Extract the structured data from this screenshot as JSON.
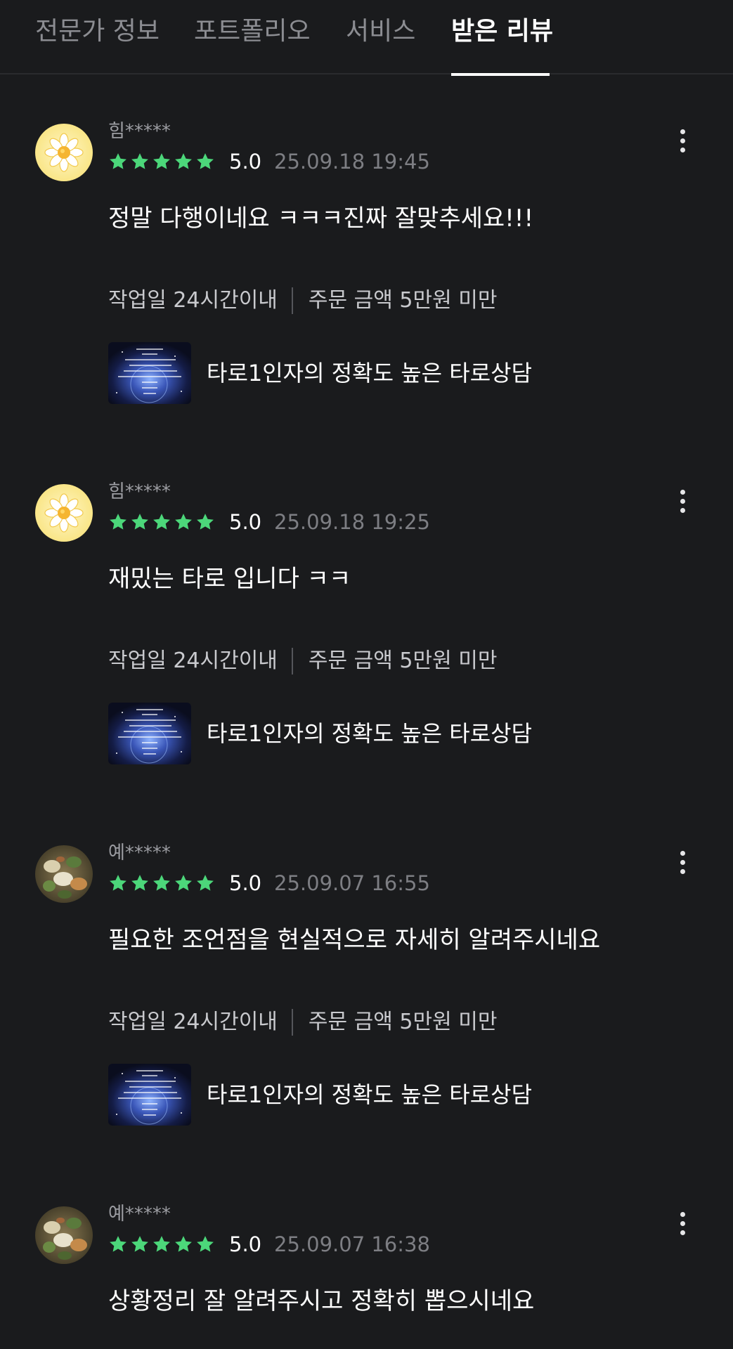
{
  "tabs": [
    {
      "label": "전문가 정보",
      "active": false
    },
    {
      "label": "포트폴리오",
      "active": false
    },
    {
      "label": "서비스",
      "active": false
    },
    {
      "label": "받은 리뷰",
      "active": true
    }
  ],
  "colors": {
    "background": "#1a1b1d",
    "star": "#4cd77a",
    "muted_text": "#7d7e83"
  },
  "reviews": [
    {
      "reviewer": "힘*****",
      "avatar_icon": "flower-avatar-icon",
      "rating": "5.0",
      "stars": 5,
      "date": "25.09.18 19:45",
      "comment": "정말 다행이네요 ㅋㅋㅋ진짜 잘맞추세요!!!",
      "work_period": "작업일 24시간이내",
      "order_amount": "주문 금액 5만원 미만",
      "service_title": "타로1인자의 정확도 높은 타로상담"
    },
    {
      "reviewer": "힘*****",
      "avatar_icon": "flower-avatar-icon",
      "rating": "5.0",
      "stars": 5,
      "date": "25.09.18 19:25",
      "comment": "재밌는 타로 입니다 ㅋㅋ",
      "work_period": "작업일 24시간이내",
      "order_amount": "주문 금액 5만원 미만",
      "service_title": "타로1인자의 정확도 높은 타로상담"
    },
    {
      "reviewer": "예*****",
      "avatar_icon": "food-photo-avatar-icon",
      "rating": "5.0",
      "stars": 5,
      "date": "25.09.07 16:55",
      "comment": "필요한 조언점을 현실적으로 자세히 알려주시네요",
      "work_period": "작업일 24시간이내",
      "order_amount": "주문 금액 5만원 미만",
      "service_title": "타로1인자의 정확도 높은 타로상담"
    },
    {
      "reviewer": "예*****",
      "avatar_icon": "food-photo-avatar-icon",
      "rating": "5.0",
      "stars": 5,
      "date": "25.09.07 16:38",
      "comment": "상황정리 잘 알려주시고 정확히 뽑으시네요"
    }
  ]
}
